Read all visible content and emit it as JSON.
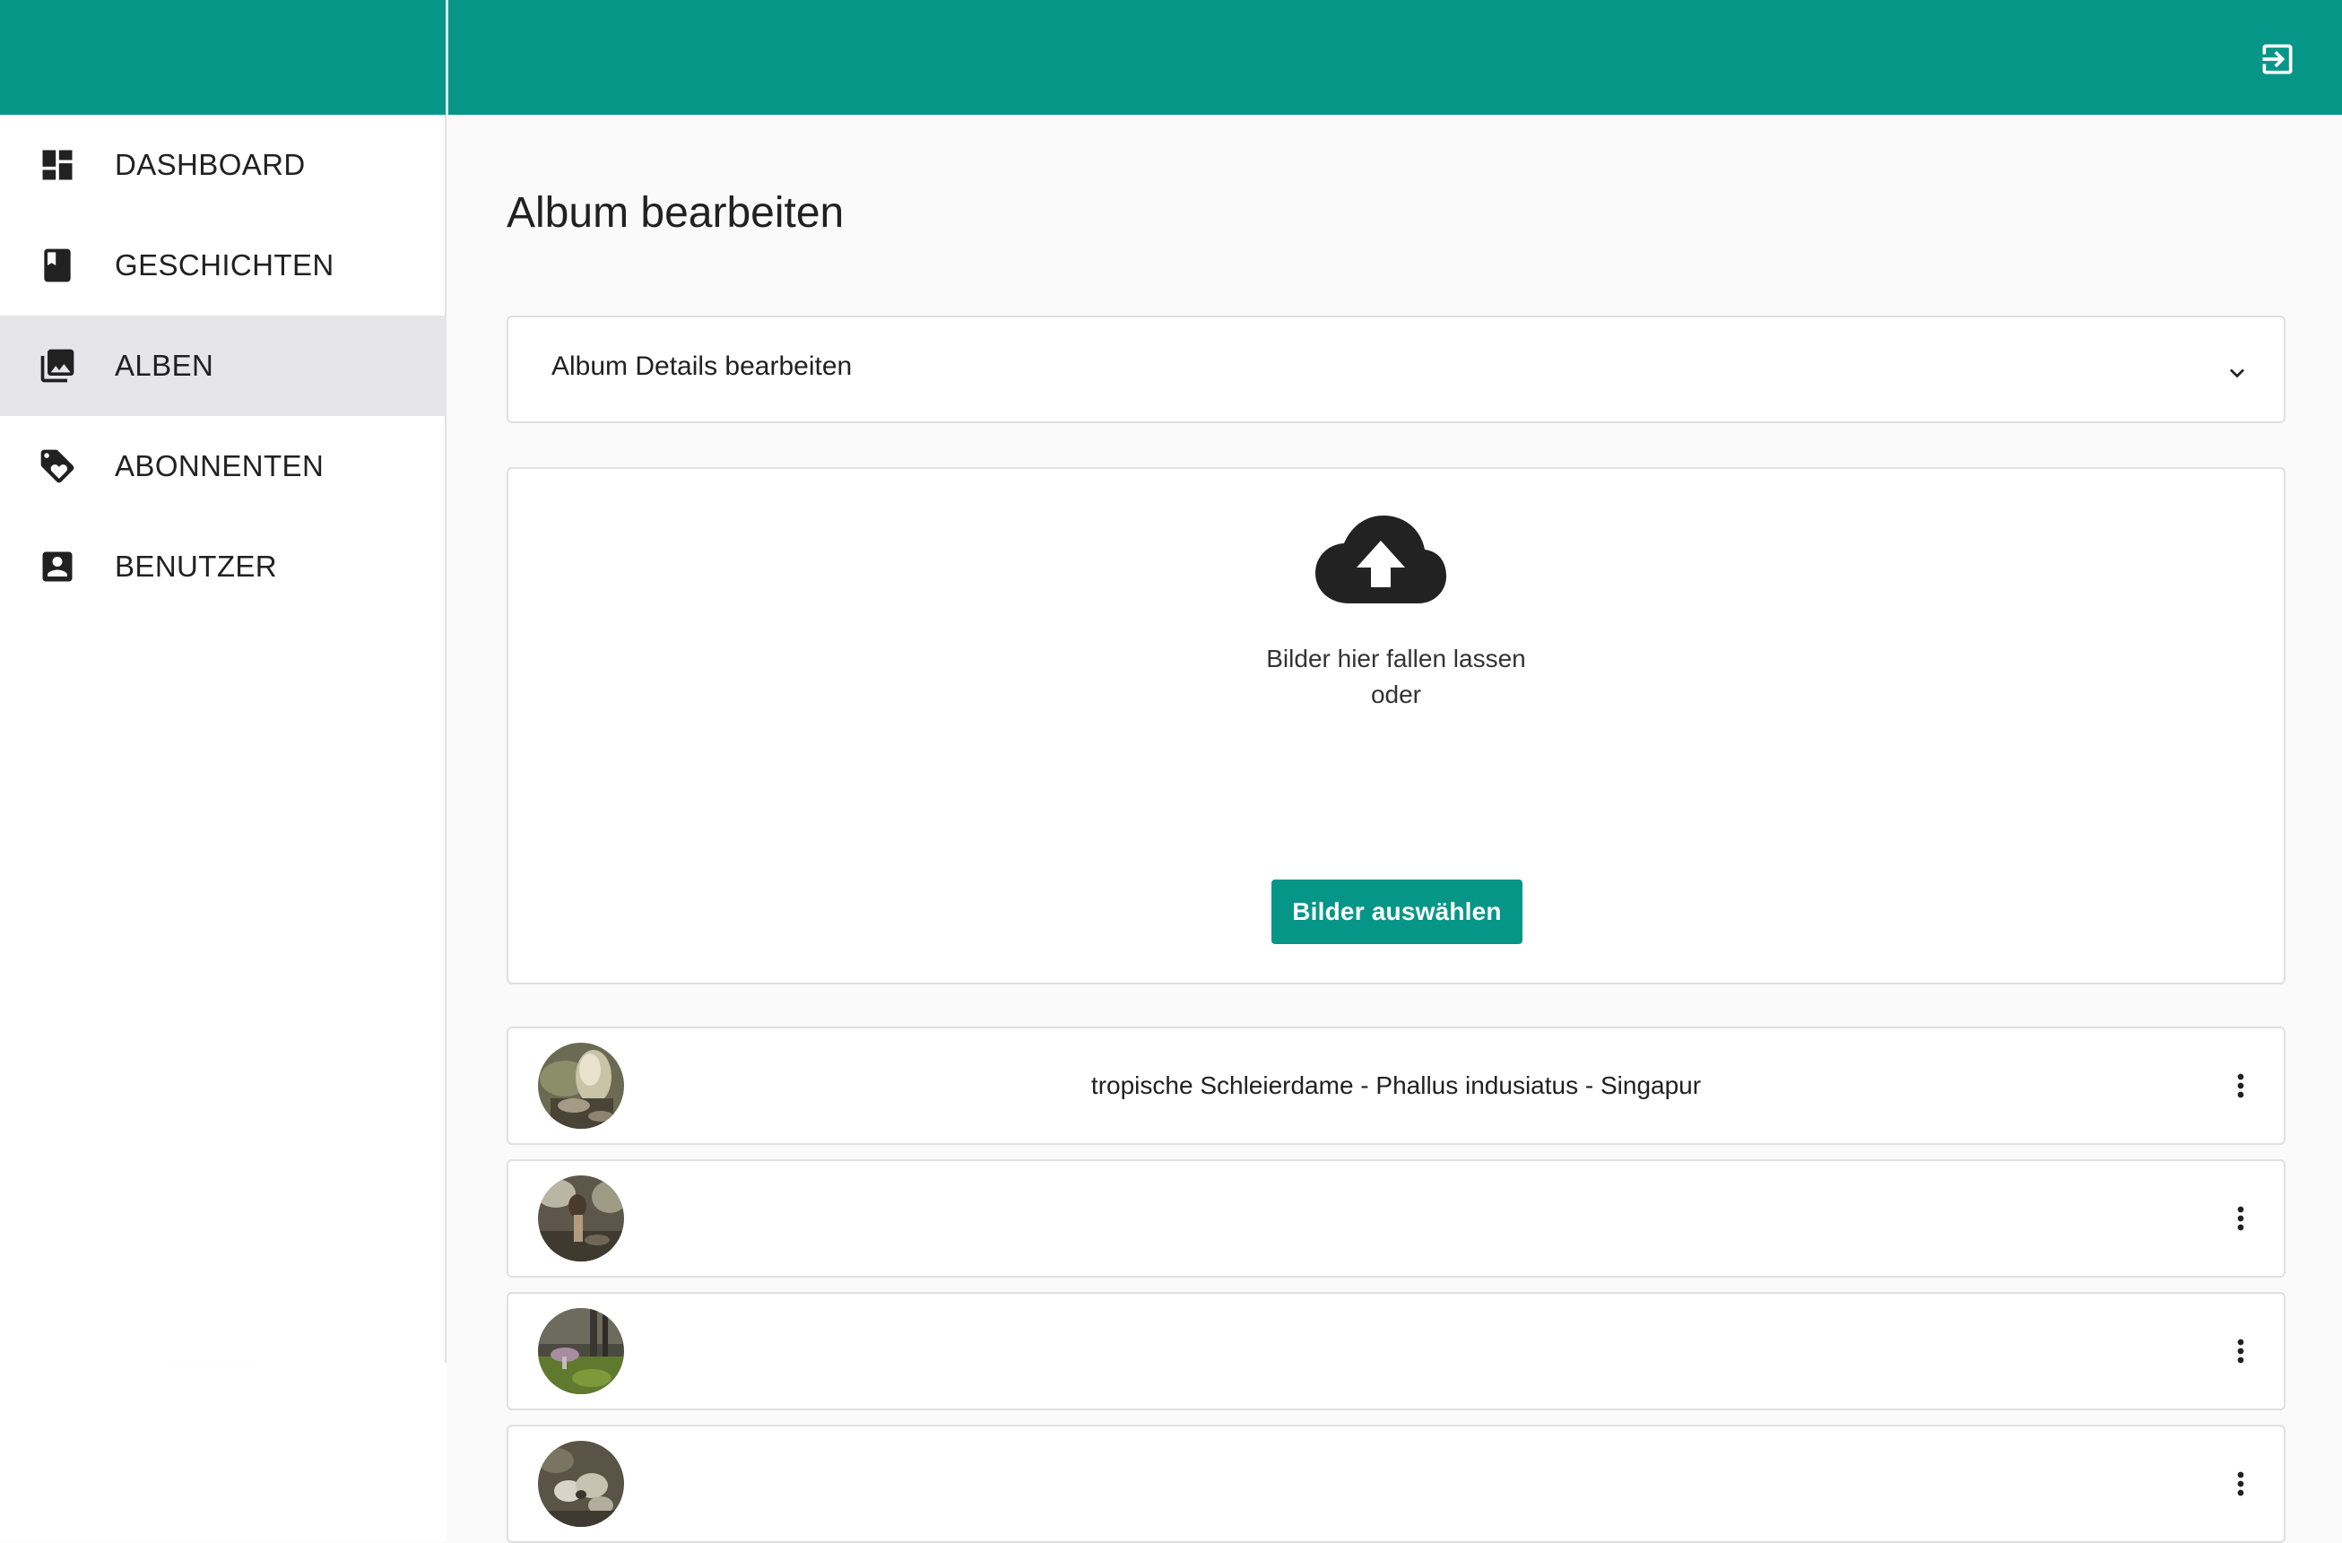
{
  "header": {
    "logout_icon": "logout-icon",
    "color": "#069688"
  },
  "sidebar": {
    "items": [
      {
        "label": "DASHBOARD",
        "icon": "dashboard-icon"
      },
      {
        "label": "GESCHICHTEN",
        "icon": "book-icon"
      },
      {
        "label": "ALBEN",
        "icon": "photo-library-icon",
        "active": true
      },
      {
        "label": "ABONNENTEN",
        "icon": "tag-heart-icon"
      },
      {
        "label": "BENUTZER",
        "icon": "account-box-icon"
      }
    ]
  },
  "main": {
    "page_title": "Album bearbeiten",
    "details_panel": {
      "label": "Album Details bearbeiten",
      "icon": "chevron-down-icon"
    },
    "upload": {
      "icon": "cloud-upload-icon",
      "drop_text": "Bilder hier fallen lassen",
      "or_text": "oder",
      "button_label": "Bilder auswählen"
    },
    "images": [
      {
        "title": "tropische Schleierdame - Phallus indusiatus - Singapur"
      },
      {
        "title": ""
      },
      {
        "title": ""
      },
      {
        "title": ""
      }
    ]
  },
  "colors": {
    "accent": "#069688",
    "active_nav_bg": "#e6e6e9",
    "page_bg": "#fafafa"
  }
}
